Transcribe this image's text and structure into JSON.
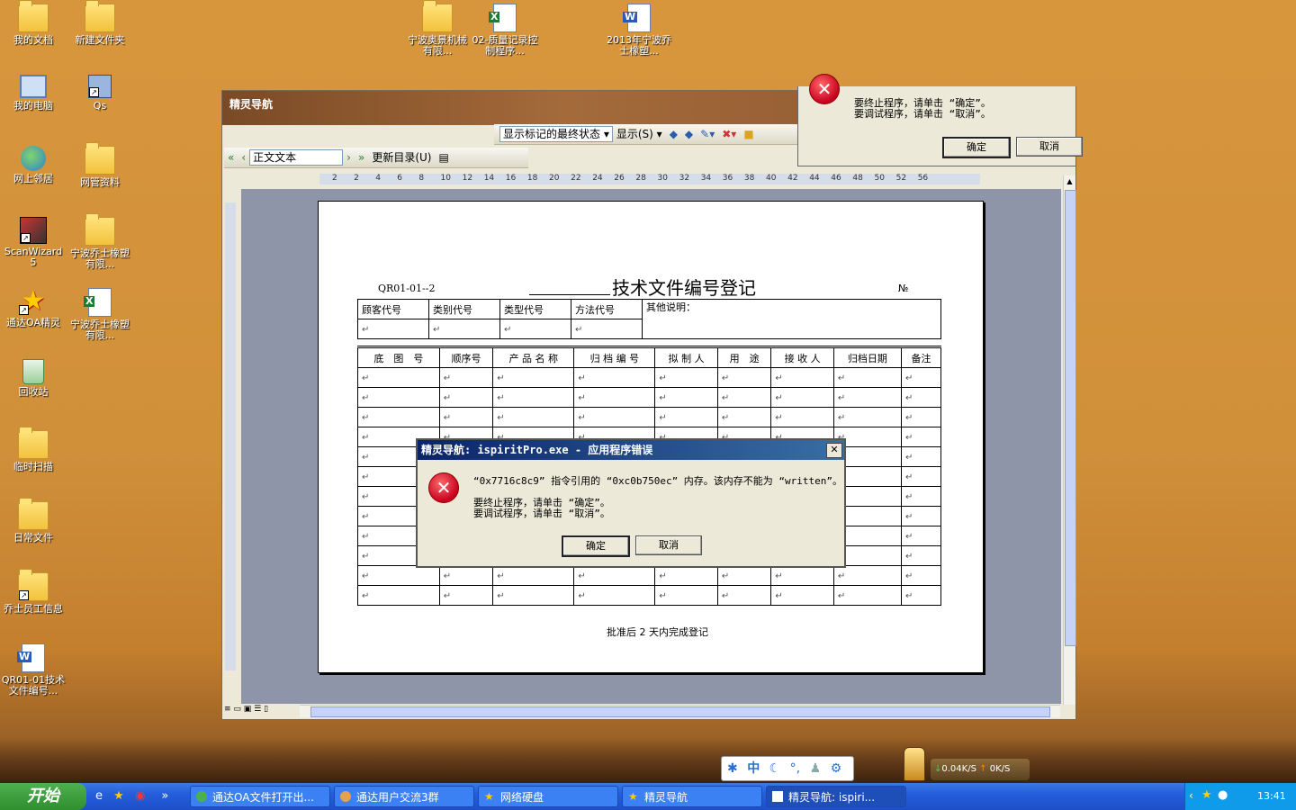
{
  "desktop": {
    "icons": [
      {
        "label": "我的文档",
        "type": "doc-folder"
      },
      {
        "label": "新建文件夹",
        "type": "folder"
      },
      {
        "label": "我的电脑",
        "type": "computer"
      },
      {
        "label": "Qs",
        "type": "shortcut"
      },
      {
        "label": "网上邻居",
        "type": "network"
      },
      {
        "label": "网管资料",
        "type": "folder"
      },
      {
        "label": "ScanWizard 5",
        "type": "app"
      },
      {
        "label": "宁波乔士橡塑有限...",
        "type": "folder"
      },
      {
        "label": "通达OA精灵",
        "type": "app"
      },
      {
        "label": "宁波乔士橡塑有限...",
        "type": "excel"
      },
      {
        "label": "回收站",
        "type": "recycle"
      },
      {
        "label": "临时扫描",
        "type": "folder"
      },
      {
        "label": "日常文件",
        "type": "folder"
      },
      {
        "label": "乔士员工信息",
        "type": "folder"
      },
      {
        "label": "QR01-01技术文件编号...",
        "type": "word"
      },
      {
        "label": "宁波奥景机械有限...",
        "type": "folder"
      },
      {
        "label": "02-质量记录控制程序...",
        "type": "excel"
      },
      {
        "label": "2013年宁波乔士橡塑...",
        "type": "word"
      }
    ]
  },
  "main_window": {
    "title": "精灵导航",
    "toolbar1": {
      "track_state": "显示标记的最终状态",
      "show_menu": "显示(S)"
    },
    "toolbar2": {
      "style": "正文文本",
      "update_toc": "更新目录(U)"
    },
    "ruler_numbers": [
      "2",
      "2",
      "4",
      "6",
      "8",
      "10",
      "12",
      "14",
      "16",
      "18",
      "20",
      "22",
      "24",
      "26",
      "28",
      "30",
      "32",
      "34",
      "36",
      "38",
      "40",
      "42",
      "44",
      "46",
      "48",
      "50",
      "52",
      "56"
    ]
  },
  "document": {
    "code": "QR01-01--2",
    "title": "技术文件编号登记",
    "number_label": "№",
    "header_table": {
      "cols": [
        "顾客代号",
        "类别代号",
        "类型代号",
        "方法代号"
      ],
      "other": "其他说明："
    },
    "main_table": {
      "headers": [
        "底　图　号",
        "顺序号",
        "产 品 名 称",
        "归 档 编 号",
        "拟 制 人",
        "用　途",
        "接 收 人",
        "归档日期",
        "备注"
      ],
      "row_count": 12
    },
    "footer": "批准后 2 天内完成登记"
  },
  "bg_dialog": {
    "line1": "要终止程序，请单击 “确定”。",
    "line2": "要调试程序，请单击 “取消”。",
    "ok": "确定",
    "cancel": "取消"
  },
  "error_dialog": {
    "title": "精灵导航: ispiritPro.exe - 应用程序错误",
    "message": "“0x7716c8c9” 指令引用的 “0xc0b750ec” 内存。该内存不能为 “written”。",
    "line1": "要终止程序，请单击 “确定”。",
    "line2": "要调试程序，请单击 “取消”。",
    "ok": "确定",
    "cancel": "取消"
  },
  "ime_bar": {
    "mode": "中"
  },
  "net_speed": {
    "down": "0.04K/S",
    "up": "0K/S"
  },
  "taskbar": {
    "start": "开始",
    "tasks": [
      {
        "label": "通达OA文件打开出..."
      },
      {
        "label": "通达用户交流3群"
      },
      {
        "label": "网络硬盘"
      },
      {
        "label": "精灵导航"
      },
      {
        "label": "精灵导航: ispiri..."
      }
    ],
    "clock": "13:41"
  }
}
